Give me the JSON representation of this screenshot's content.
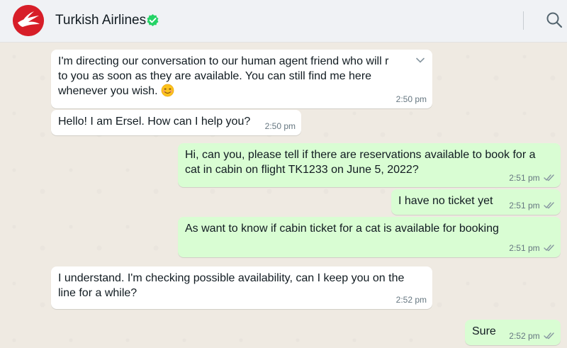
{
  "header": {
    "contact_name": "Turkish Airlines",
    "avatar_icon": "turkish-airlines-logo",
    "verified_icon": "verified-badge-icon",
    "search_icon": "search-icon"
  },
  "colors": {
    "incoming_bubble": "#ffffff",
    "outgoing_bubble": "#d9fdd3",
    "brand_red": "#d71e28",
    "verified_green": "#25d366",
    "read_ticks": "#8696a0"
  },
  "messages": [
    {
      "direction": "in",
      "text": "I'm directing our conversation to our human agent friend who will r\nto you as soon as they are available. You can still find me here\nwhenever you wish.",
      "emoji": "smiling-face-emoji",
      "time": "2:50 pm"
    },
    {
      "direction": "in",
      "text": "Hello! I am Ersel. How can I help you?",
      "time": "2:50 pm"
    },
    {
      "direction": "out",
      "text": "Hi, can you, please tell if there are reservations available to book for a\ncat in cabin on flight TK1233 on June 5, 2022?",
      "time": "2:51 pm",
      "status": "read"
    },
    {
      "direction": "out",
      "text": "I have no ticket yet",
      "time": "2:51 pm",
      "status": "read"
    },
    {
      "direction": "out",
      "text": "As want to know if cabin ticket for a cat is available for booking",
      "time": "2:51 pm",
      "status": "read"
    },
    {
      "direction": "in",
      "text": "I understand. I'm checking possible availability, can I keep you on the\nline for a while?",
      "time": "2:52 pm"
    },
    {
      "direction": "out",
      "text": "Sure",
      "time": "2:52 pm",
      "status": "read"
    }
  ]
}
